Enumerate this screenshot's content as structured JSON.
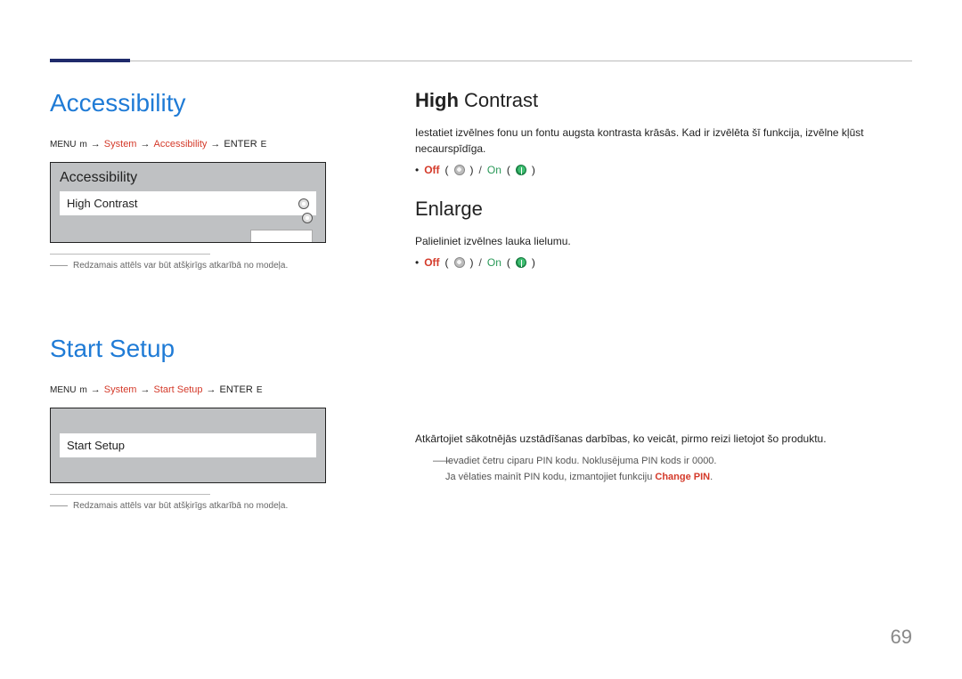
{
  "page_number": "69",
  "left": {
    "accessibility": {
      "title": "Accessibility",
      "breadcrumb": {
        "menu_label": "MENU",
        "menu_glyph": "m",
        "system": "System",
        "accessibility": "Accessibility",
        "enter_label": "ENTER",
        "enter_glyph": "E",
        "arrow": "→"
      },
      "preview": {
        "panel_title": "Accessibility",
        "row_label": "High Contrast"
      },
      "footnote": "Redzamais attēls var būt atšķirīgs atkarībā no modeļa.",
      "footnote_marker": "――"
    },
    "startsetup": {
      "title": "Start Setup",
      "breadcrumb": {
        "menu_label": "MENU",
        "menu_glyph": "m",
        "system": "System",
        "startsetup": "Start Setup",
        "enter_label": "ENTER",
        "enter_glyph": "E",
        "arrow": "→"
      },
      "preview": {
        "row_label": "Start Setup"
      },
      "footnote": "Redzamais attēls var būt atšķirīgs atkarībā no modeļa.",
      "footnote_marker": "――"
    }
  },
  "right": {
    "highcontrast": {
      "heading_bold": "High",
      "heading_rest": " Contrast",
      "desc": "Iestatiet izvēlnes fonu un fontu augsta kontrasta krāsās. Kad ir izvēlēta šī funkcija, izvēlne kļūst necaurspīdīga.",
      "opt": {
        "off": "Off",
        "on": "On",
        "bullet": "•",
        "open": "(",
        "close": ")",
        "slash": "/"
      }
    },
    "enlarge": {
      "heading": "Enlarge",
      "desc": "Palieliniet izvēlnes lauka lielumu.",
      "opt": {
        "off": "Off",
        "on": "On",
        "bullet": "•",
        "open": "(",
        "close": ")",
        "slash": "/"
      }
    },
    "startsetup": {
      "desc": "Atkārtojiet sākotnējās uzstādīšanas darbības, ko veicāt, pirmo reizi lietojot šo produktu.",
      "note1_marker": "――",
      "note1": "Ievadiet četru ciparu PIN kodu. Noklusējuma PIN kods ir 0000.",
      "note2_prefix": "Ja vēlaties mainīt PIN kodu, izmantojiet funkciju ",
      "note2_highlight": "Change PIN",
      "note2_suffix": "."
    }
  }
}
